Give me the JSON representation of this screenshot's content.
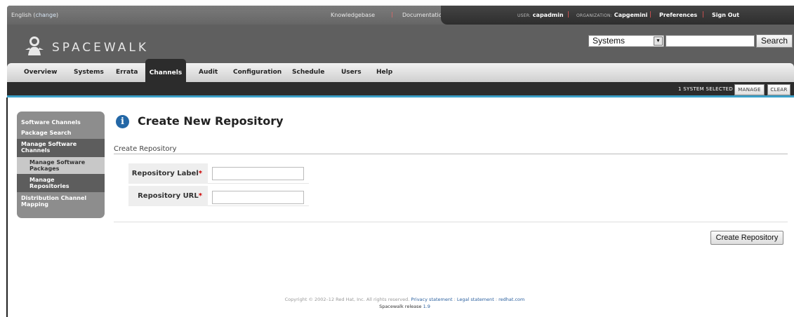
{
  "utility": {
    "language": "English",
    "change_label": "change",
    "knowledgebase": "Knowledgebase",
    "documentation": "Documentation"
  },
  "user_bar": {
    "user_prefix": "USER:",
    "user": "capadmin",
    "org_prefix": "ORGANIZATION:",
    "organization": "Capgemini",
    "preferences": "Preferences",
    "sign_out": "Sign Out"
  },
  "logo": {
    "text": "SPACEWALK"
  },
  "search": {
    "selected_option": "Systems",
    "value": "",
    "button_label": "Search"
  },
  "tabs": [
    {
      "label": "Overview"
    },
    {
      "label": "Systems"
    },
    {
      "label": "Errata"
    },
    {
      "label": "Channels",
      "active": true
    },
    {
      "label": "Audit"
    },
    {
      "label": "Configuration"
    },
    {
      "label": "Schedule"
    },
    {
      "label": "Users"
    },
    {
      "label": "Help"
    }
  ],
  "system_bar": {
    "selected_text": "1 SYSTEM SELECTED",
    "manage_label": "MANAGE",
    "clear_label": "CLEAR"
  },
  "sidebar": {
    "items": [
      {
        "label": "Software Channels"
      },
      {
        "label": "Package Search"
      },
      {
        "label": "Manage Software Channels"
      },
      {
        "label": "Manage Software Packages"
      },
      {
        "label": "Manage Repositories"
      },
      {
        "label": "Distribution Channel Mapping"
      }
    ]
  },
  "main": {
    "page_title": "Create New Repository",
    "section_title": "Create Repository",
    "fields": [
      {
        "label": "Repository Label",
        "required_mark": "*",
        "value": ""
      },
      {
        "label": "Repository URL",
        "required_mark": "*",
        "value": ""
      }
    ],
    "submit_label": "Create Repository"
  },
  "footer": {
    "copyright": "Copyright © 2002–12 Red Hat, Inc. All rights reserved.",
    "privacy": "Privacy statement",
    "legal": "Legal statement",
    "redhat": "redhat.com",
    "release_prefix": "Spacewalk release",
    "release_version": "1.9"
  },
  "colors": {
    "header_gray": "#5f5f5f",
    "nav_dark": "#2c2c2c",
    "accent_blue": "#3ba0c8",
    "info_icon_blue": "#2367a6",
    "required_red": "#cc0000",
    "link_blue": "#2a5f9e"
  }
}
